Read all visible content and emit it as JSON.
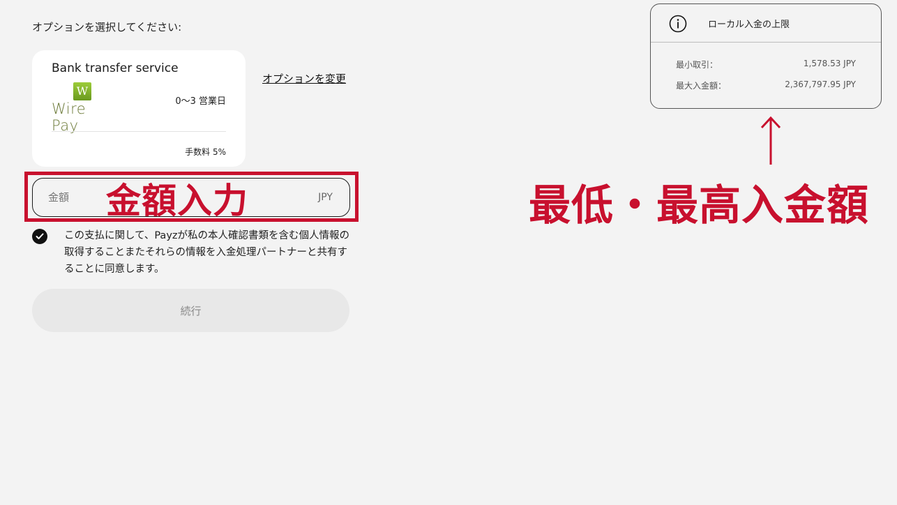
{
  "form": {
    "select_label": "オプションを選択してください:",
    "option": {
      "title": "Bank transfer service",
      "logo_badge": "W",
      "logo_text": "Wire Pay",
      "processing_time": "0〜3 営業日",
      "fee": "手数料 5%"
    },
    "change_link": "オプションを変更",
    "amount": {
      "placeholder": "金額",
      "value": "",
      "currency": "JPY"
    },
    "consent_text": "この支払に関して、Payzが私の本人確認書類を含む個人情報の取得することまたそれらの情報を入金処理パートナーと共有することに同意します。",
    "consent_checked": true,
    "continue_label": "続行"
  },
  "limits": {
    "title": "ローカル入金の上限",
    "min_label": "最小取引：",
    "min_value": "1,578.53 JPY",
    "max_label": "最大入金額：",
    "max_value": "2,367,797.95 JPY"
  },
  "annotations": {
    "amount_label": "金額入力",
    "limits_label": "最低・最高入金額",
    "accent_color": "#c8102e"
  },
  "icons": {
    "check": "check-circle-icon",
    "info": "info-icon",
    "arrow": "arrow-up-icon"
  }
}
